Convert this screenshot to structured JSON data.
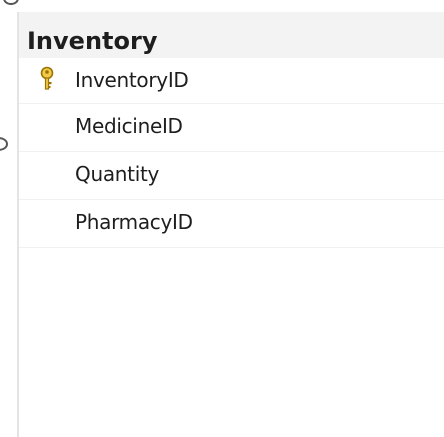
{
  "table": {
    "title": "Inventory",
    "fields": [
      {
        "name": "InventoryID",
        "icon": "primary-key-icon"
      },
      {
        "name": "MedicineID",
        "icon": ""
      },
      {
        "name": "Quantity",
        "icon": ""
      },
      {
        "name": "PharmacyID",
        "icon": ""
      }
    ]
  },
  "colors": {
    "header_bg": "#f3f3f3",
    "key_gold": "#d8a90b",
    "text": "#1e1e1e",
    "border": "#e4e4e4"
  }
}
